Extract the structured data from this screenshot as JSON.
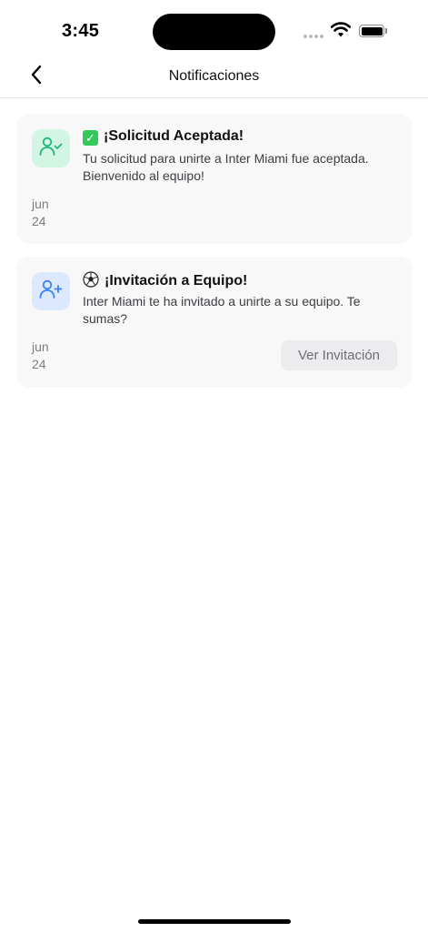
{
  "status_bar": {
    "time": "3:45"
  },
  "nav": {
    "title": "Notificaciones",
    "back_icon": "chevron-left-icon"
  },
  "notifications": [
    {
      "icon": "user-check-icon",
      "icon_color": "#1fb97a",
      "icon_bg": "#d3f5e3",
      "emoji": "✅",
      "title": "¡Solicitud Aceptada!",
      "body": "Tu solicitud para unirte a Inter Miami fue aceptada. Bienvenido al equipo!",
      "date_month": "jun",
      "date_day": "24"
    },
    {
      "icon": "user-plus-icon",
      "icon_color": "#3b82f6",
      "icon_bg": "#dbe8fd",
      "emoji": "⚽",
      "title": "¡Invitación a Equipo!",
      "body": "Inter Miami te ha invitado a unirte a su equipo. Te sumas?",
      "date_month": "jun",
      "date_day": "24",
      "action_label": "Ver Invitación"
    }
  ]
}
